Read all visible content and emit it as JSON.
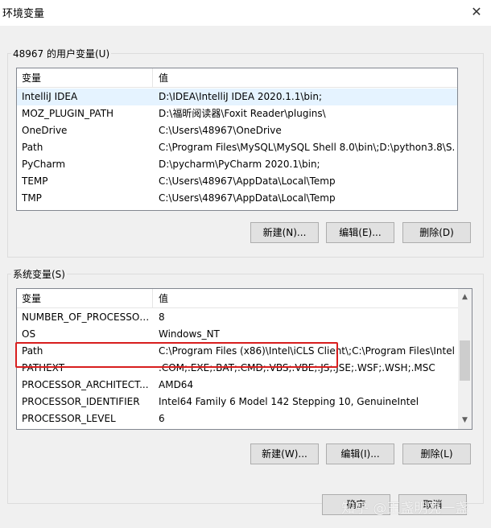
{
  "window": {
    "title": "环境变量",
    "close_glyph": "✕"
  },
  "user_vars": {
    "group_label": "48967 的用户变量(U)",
    "headers": [
      "变量",
      "值"
    ],
    "rows": [
      {
        "name": "IntelliJ IDEA",
        "value": "D:\\IDEA\\IntelliJ IDEA 2020.1.1\\bin;"
      },
      {
        "name": "MOZ_PLUGIN_PATH",
        "value": "D:\\福昕阅读器\\Foxit Reader\\plugins\\"
      },
      {
        "name": "OneDrive",
        "value": "C:\\Users\\48967\\OneDrive"
      },
      {
        "name": "Path",
        "value": "C:\\Program Files\\MySQL\\MySQL Shell 8.0\\bin\\;D:\\python3.8\\S..."
      },
      {
        "name": "PyCharm",
        "value": "D:\\pycharm\\PyCharm 2020.1\\bin;"
      },
      {
        "name": "TEMP",
        "value": "C:\\Users\\48967\\AppData\\Local\\Temp"
      },
      {
        "name": "TMP",
        "value": "C:\\Users\\48967\\AppData\\Local\\Temp"
      }
    ],
    "buttons": {
      "new": "新建(N)...",
      "edit": "编辑(E)...",
      "delete": "删除(D)"
    }
  },
  "system_vars": {
    "group_label": "系统变量(S)",
    "headers": [
      "变量",
      "值"
    ],
    "rows": [
      {
        "name": "NUMBER_OF_PROCESSORS",
        "value": "8"
      },
      {
        "name": "OS",
        "value": "Windows_NT"
      },
      {
        "name": "Path",
        "value": "C:\\Program Files (x86)\\Intel\\iCLS Client\\;C:\\Program Files\\Intel..."
      },
      {
        "name": "PATHEXT",
        "value": ".COM;.EXE;.BAT;.CMD;.VBS;.VBE;.JS;.JSE;.WSF;.WSH;.MSC"
      },
      {
        "name": "PROCESSOR_ARCHITECT...",
        "value": "AMD64"
      },
      {
        "name": "PROCESSOR_IDENTIFIER",
        "value": "Intel64 Family 6 Model 142 Stepping 10, GenuineIntel"
      },
      {
        "name": "PROCESSOR_LEVEL",
        "value": "6"
      }
    ],
    "buttons": {
      "new": "新建(W)...",
      "edit": "编辑(I)...",
      "delete": "删除(L)"
    }
  },
  "footer": {
    "ok": "确定",
    "cancel": "取消"
  },
  "watermark": "知乎 @王盏明亮一盏",
  "colors": {
    "annotation": "#d81e1e",
    "selection": "#e5f3ff"
  }
}
